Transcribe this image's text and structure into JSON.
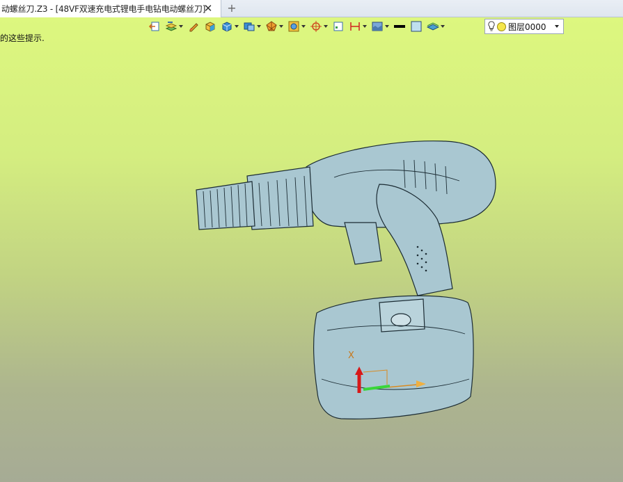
{
  "tab": {
    "title": "动螺丝刀.Z3 - [48VF双速充电式锂电手电钻电动螺丝刀]",
    "close_glyph": "✕",
    "add_glyph": "+"
  },
  "hint": "的这些提示.",
  "toolbar": {
    "icons": [
      "undo-view-icon",
      "layers-icon",
      "pencil-icon",
      "solid-box-icon",
      "shaded-box-icon",
      "view-cube-icon",
      "render-mode-icon",
      "display-style-icon",
      "snap-target-icon",
      "grid-toggle-icon",
      "dimension-icon",
      "background-icon",
      "line-color-swatch",
      "fill-color-swatch",
      "plane-icon"
    ],
    "layer": {
      "name": "图层0000",
      "bulb": "lightbulb-icon",
      "color": "#f5e64a"
    }
  },
  "triad": {
    "x_label": "X"
  },
  "colors": {
    "model_fill": "#a9c7d1",
    "model_stroke": "#1b2b33",
    "viewport_top": "#ddf77f",
    "viewport_bottom": "#a6ab95"
  }
}
